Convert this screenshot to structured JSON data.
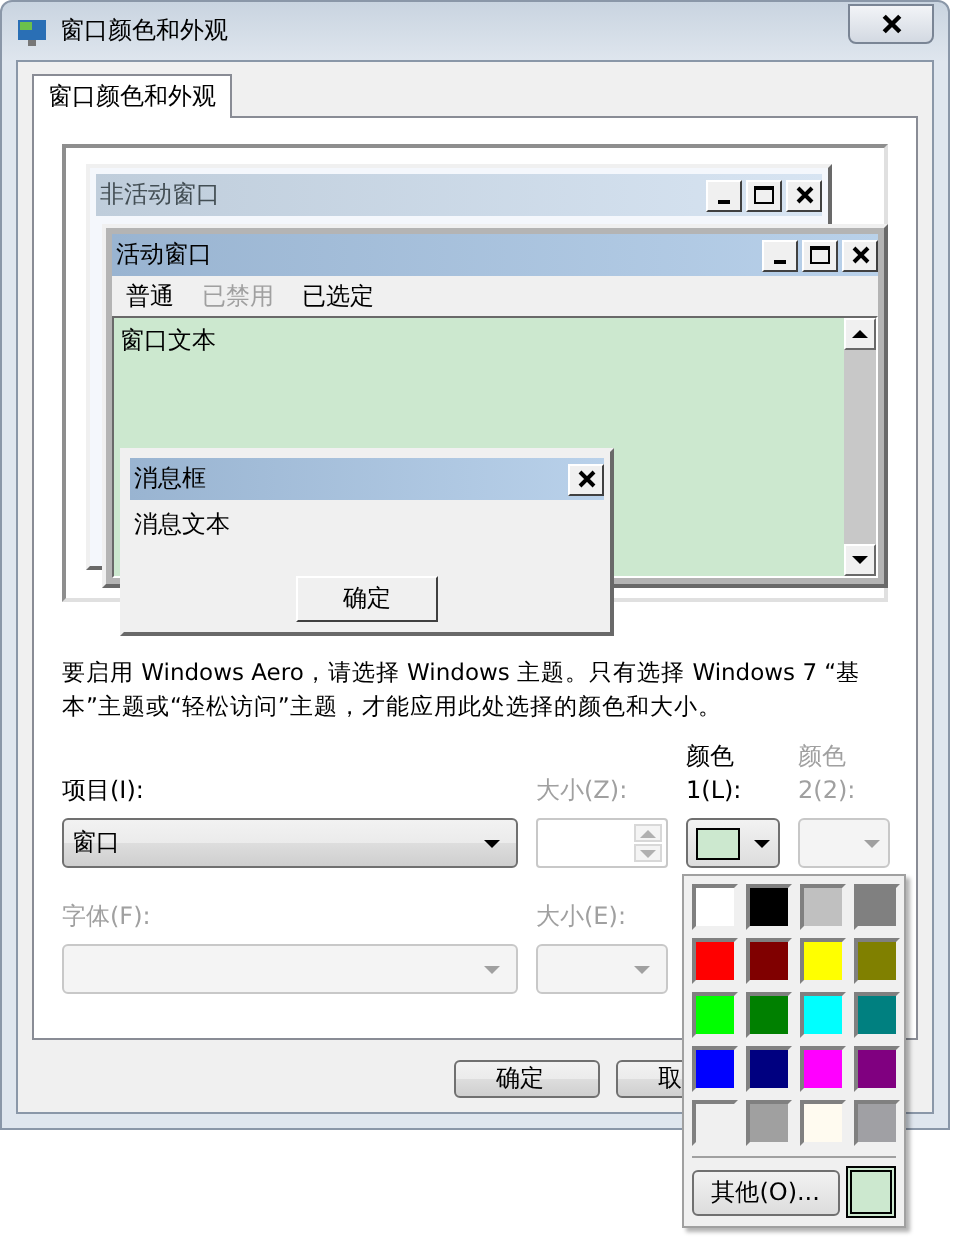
{
  "window": {
    "title": "窗口颜色和外观"
  },
  "tabs": [
    {
      "label": "窗口颜色和外观",
      "selected": true
    }
  ],
  "preview": {
    "inactive_window": {
      "title": "非活动窗口"
    },
    "active_window": {
      "title": "活动窗口",
      "menu": [
        {
          "label": "普通",
          "disabled": false
        },
        {
          "label": "已禁用",
          "disabled": true
        },
        {
          "label": "已选定",
          "disabled": false
        }
      ],
      "text": "窗口文本"
    },
    "message_box": {
      "title": "消息框",
      "text": "消息文本",
      "button": "确定"
    }
  },
  "description": "要启用 Windows Aero，请选择 Windows 主题。只有选择 Windows 7 “基本”主题或“轻松访问”主题，才能应用此处选择的颜色和大小。",
  "item": {
    "label": "项目(I):",
    "value": "窗口"
  },
  "size": {
    "label": "大小(Z):",
    "disabled": true
  },
  "color1": {
    "label_top": "颜色",
    "label_bottom": "1(L):",
    "color": "#cce8cf",
    "disabled": false
  },
  "color2": {
    "label_top": "颜色",
    "label_bottom": "2(2):",
    "disabled": true
  },
  "font": {
    "label": "字体(F):",
    "disabled": true
  },
  "font_size": {
    "label": "大小(E):",
    "disabled": true
  },
  "buttons": [
    {
      "label": "确定"
    },
    {
      "label": "取"
    }
  ],
  "color_menu": {
    "swatches": [
      {
        "color": "#ffffff"
      },
      {
        "color": "#000000"
      },
      {
        "color": "#c0c0c0"
      },
      {
        "color": "#808080"
      },
      {
        "color": "#ff0000"
      },
      {
        "color": "#800000"
      },
      {
        "color": "#ffff00"
      },
      {
        "color": "#808000"
      },
      {
        "color": "#00ff00"
      },
      {
        "color": "#008000"
      },
      {
        "color": "#00ffff"
      },
      {
        "color": "#008080"
      },
      {
        "color": "#0000ff"
      },
      {
        "color": "#000080"
      },
      {
        "color": "#ff00ff"
      },
      {
        "color": "#800080"
      },
      {
        "color": "#f0f0f0"
      },
      {
        "color": "#a0a0a0"
      },
      {
        "color": "#fffbf0"
      },
      {
        "color": "#a0a0a4"
      }
    ],
    "other_button": "其他(O)...",
    "custom": {
      "color": "#cce8cf",
      "selected": true
    }
  }
}
